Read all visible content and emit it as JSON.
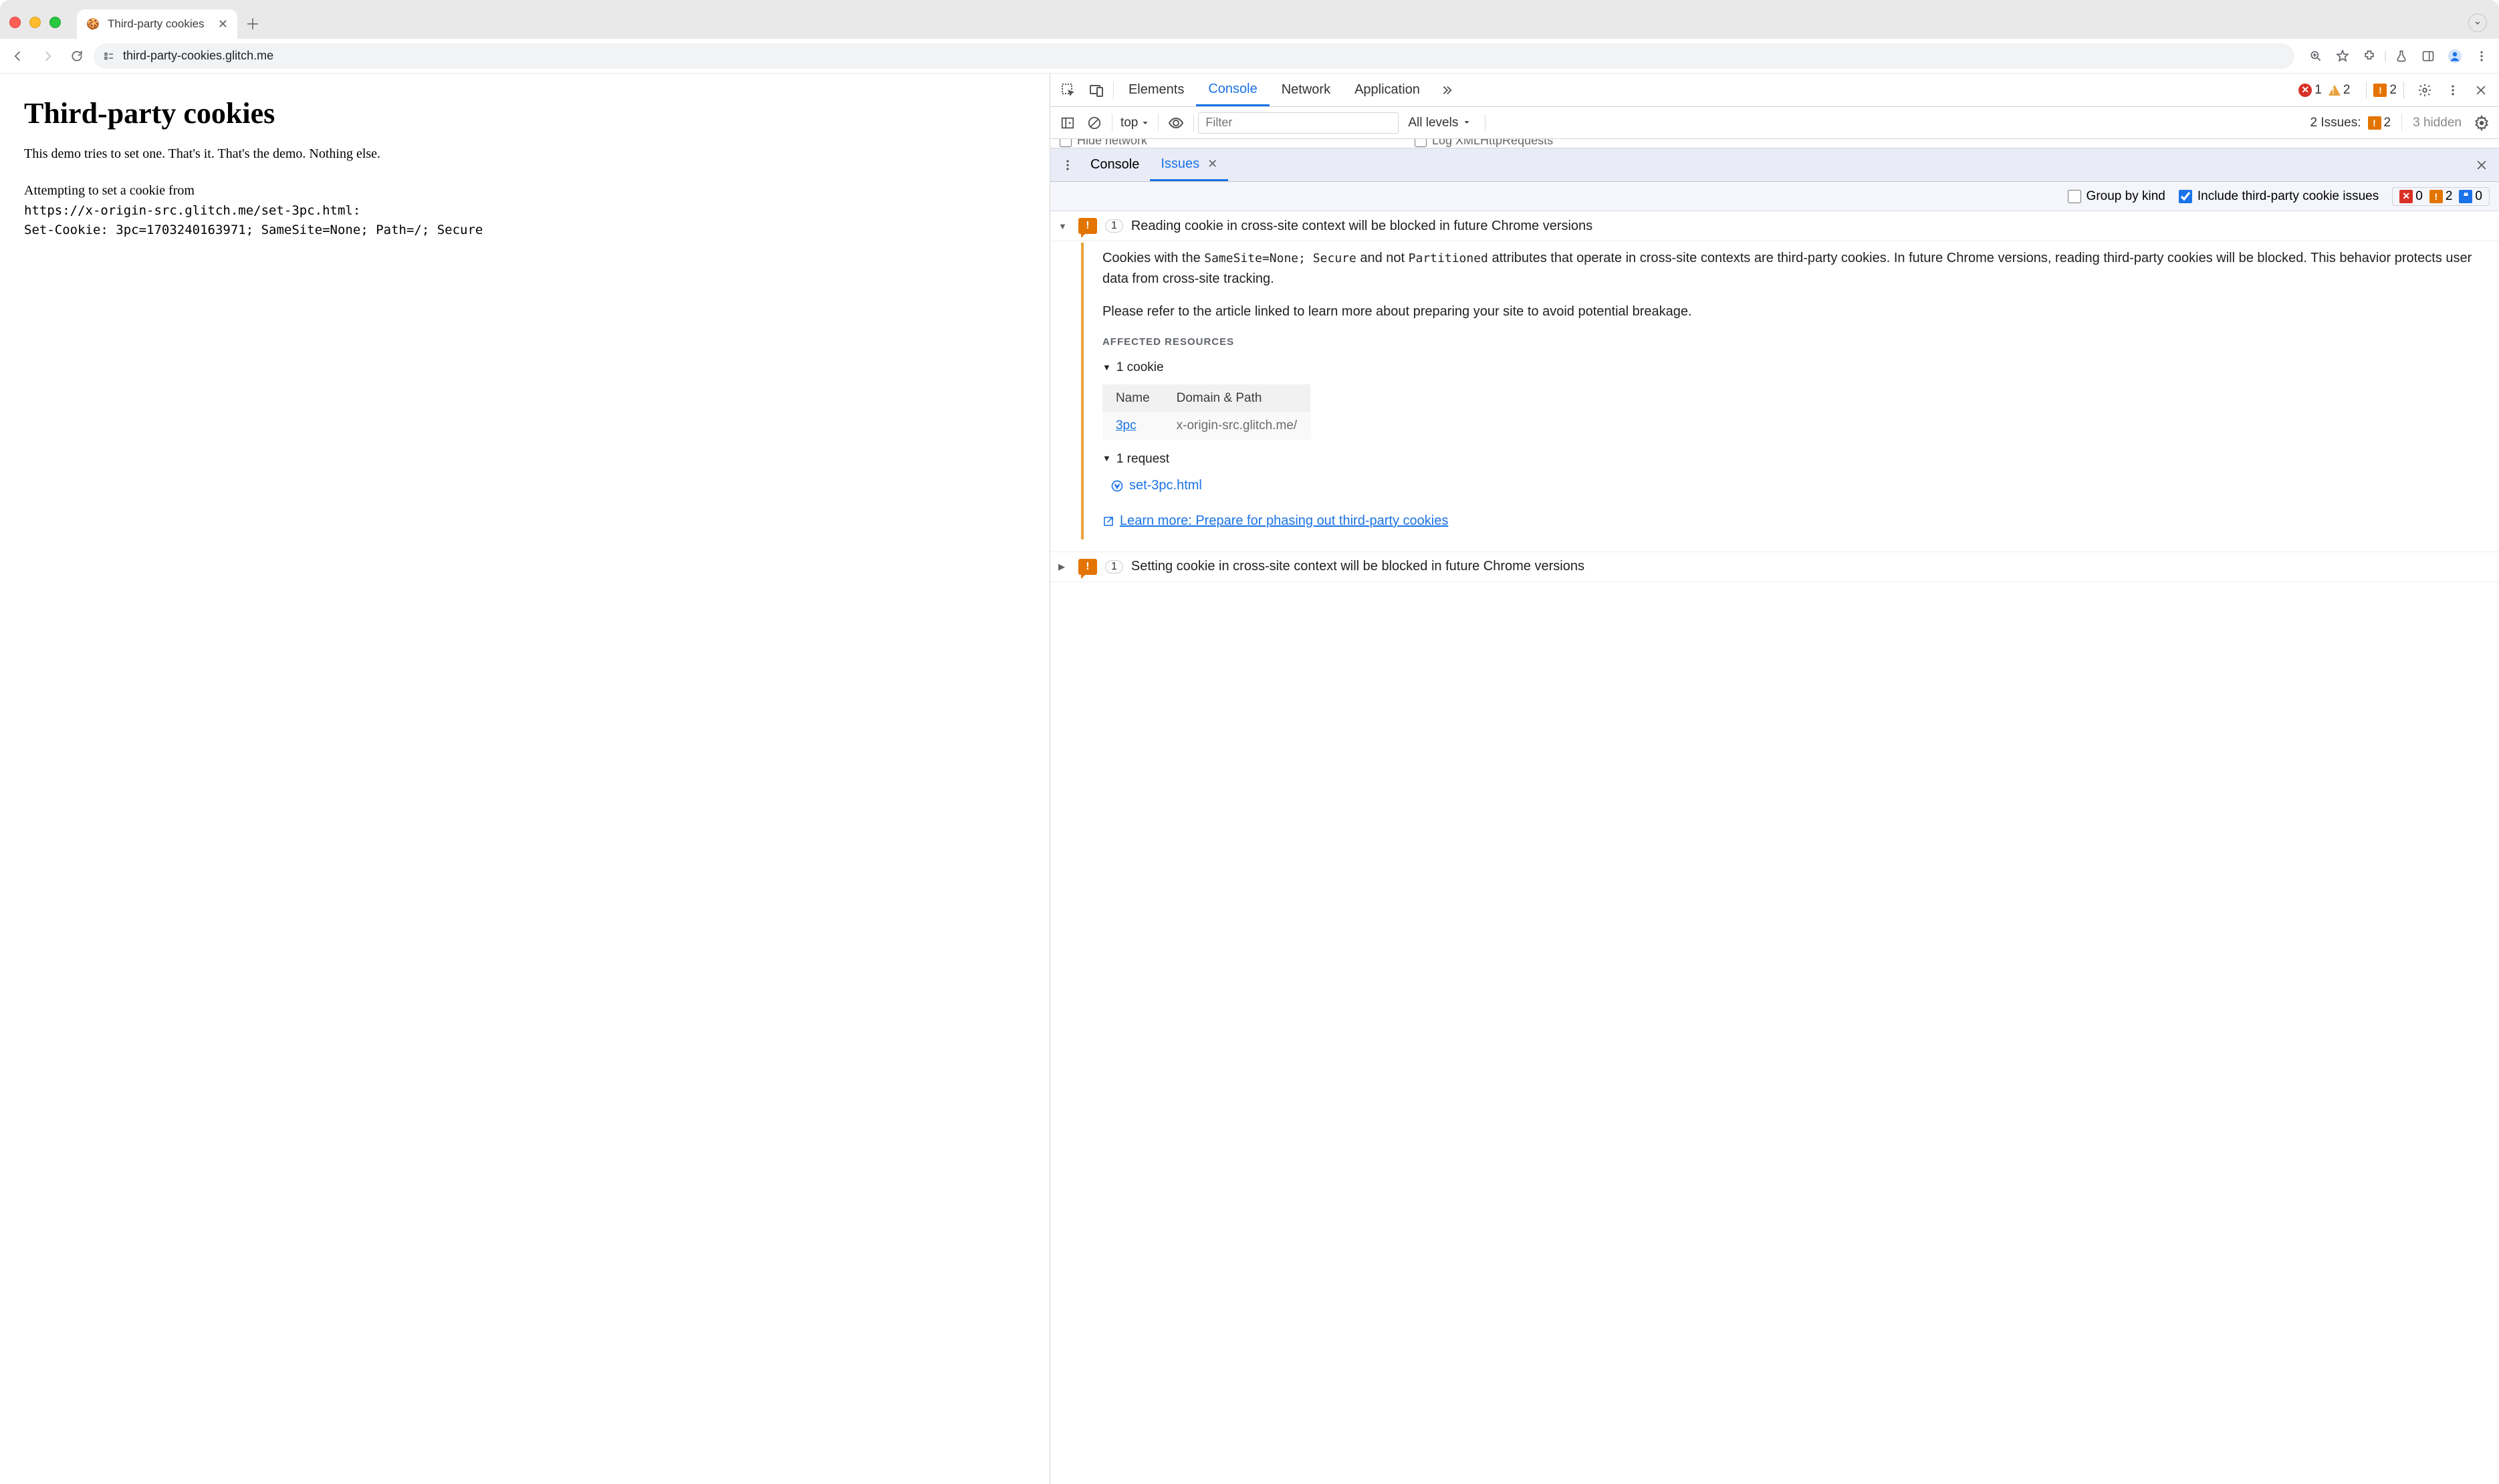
{
  "browser": {
    "tab_title": "Third-party cookies",
    "url": "third-party-cookies.glitch.me"
  },
  "page": {
    "heading": "Third-party cookies",
    "demo_text": "This demo tries to set one. That's it. That's the demo. Nothing else.",
    "attempt_line": "Attempting to set a cookie from",
    "attempt_url": "https://x-origin-src.glitch.me/set-3pc.html:",
    "set_cookie": "Set-Cookie: 3pc=1703240163971; SameSite=None; Path=/; Secure"
  },
  "devtools": {
    "tabs": {
      "elements": "Elements",
      "console": "Console",
      "network": "Network",
      "application": "Application"
    },
    "status": {
      "errors": "1",
      "warnings": "2",
      "issues": "2"
    },
    "toolbar": {
      "context": "top",
      "filter_placeholder": "Filter",
      "levels": "All levels",
      "issues_label": "2 Issues:",
      "issues_count": "2",
      "hidden": "3 hidden"
    },
    "extra": {
      "hide_network": "Hide network",
      "log_xml": "Log XMLHttpRequests"
    },
    "drawer": {
      "console": "Console",
      "issues": "Issues"
    },
    "issues_filter": {
      "group_by_kind": "Group by kind",
      "include_3p": "Include third-party cookie issues",
      "counts": {
        "err": "0",
        "warn": "2",
        "chat": "0"
      }
    },
    "issues": {
      "first": {
        "count": "1",
        "title": "Reading cookie in cross-site context will be blocked in future Chrome versions",
        "para1_a": "Cookies with the ",
        "para1_code1": "SameSite=None; Secure",
        "para1_b": " and not ",
        "para1_code2": "Partitioned",
        "para1_c": " attributes that operate in cross-site contexts are third-party cookies. In future Chrome versions, reading third-party cookies will be blocked. This behavior protects user data from cross-site tracking.",
        "para2": "Please refer to the article linked to learn more about preparing your site to avoid potential breakage.",
        "affected_heading": "AFFECTED RESOURCES",
        "cookie_sub": "1 cookie",
        "th_name": "Name",
        "th_domain": "Domain & Path",
        "cookie_name": "3pc",
        "cookie_domain": "x-origin-src.glitch.me/",
        "request_sub": "1 request",
        "request_name": "set-3pc.html",
        "learn_more": "Learn more: Prepare for phasing out third-party cookies"
      },
      "second": {
        "count": "1",
        "title": "Setting cookie in cross-site context will be blocked in future Chrome versions"
      }
    }
  }
}
